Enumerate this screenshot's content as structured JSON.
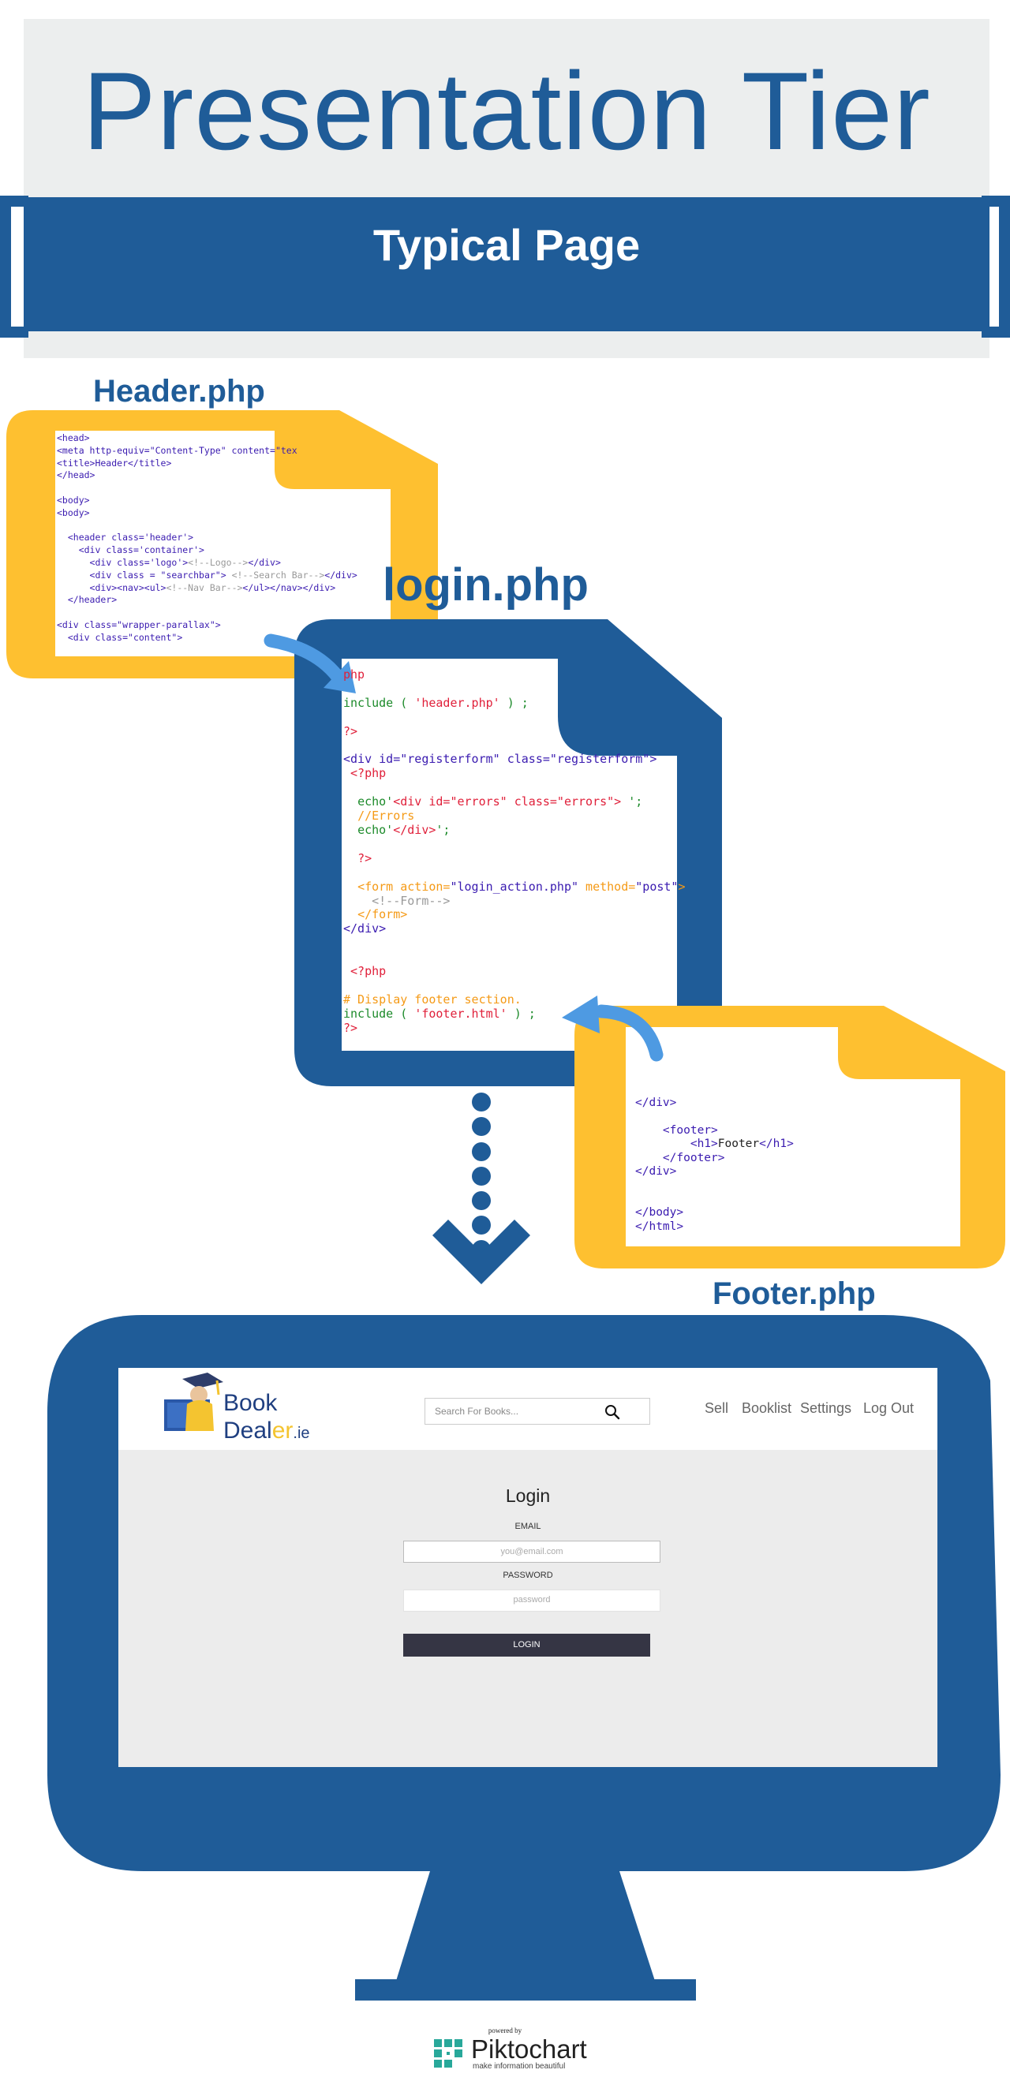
{
  "title": "Presentation Tier",
  "subtitle": "Typical Page",
  "files": {
    "header_label": "Header.php",
    "login_label": "login.php",
    "footer_label": "Footer.php"
  },
  "header_code": {
    "l1": "<head>",
    "l2": "<meta http-equiv=\"Content-Type\" content=\"tex",
    "l3": "<title>Header</title>",
    "l4": "</head>",
    "l5": "<body>",
    "l6": "<body>",
    "l7": "<header class='header'>",
    "l8": "<div class='container'>",
    "l9a": "<div class='logo'>",
    "l9b": "<!--Logo-->",
    "l9c": "</div>",
    "l10a": "<div class = \"searchbar\">",
    "l10b": " <!--Search Bar-->",
    "l10c": "</div>",
    "l11a": "<div><nav><ul>",
    "l11b": "<!--Nav Bar-->",
    "l11c": "</ul></nav></div>",
    "l12": "</header>",
    "l13": "<div class=\"wrapper-parallax\">",
    "l14": "<div class=\"content\">"
  },
  "login_code": {
    "l1": "php",
    "l2a": "include ( ",
    "l2b": "'header.php'",
    "l2c": " ) ;",
    "l3": "?>",
    "l4": "<div id=\"registerform\" class=\"registerform\">",
    "l5": "<?php",
    "l6a": "echo'",
    "l6b": "<div id=\"errors\" class=\"errors\">",
    "l6c": " ';",
    "l7": "//Errors",
    "l8a": "echo'",
    "l8b": "</div>",
    "l8c": "';",
    "l9": "?>",
    "l10a": "<form action=",
    "l10b": "\"login_action.php\"",
    "l10c": " method=",
    "l10d": "\"post\"",
    "l10e": ">",
    "l11": "<!--Form-->",
    "l12": "</form>",
    "l13": "</div>",
    "l14": "<?php",
    "l15": "# Display footer section.",
    "l16a": "include ( ",
    "l16b": "'footer.html'",
    "l16c": " ) ;",
    "l17": "?>"
  },
  "footer_code": {
    "l1": "</div>",
    "l2": "<footer>",
    "l3a": "<h1>",
    "l3b": "Footer",
    "l3c": "</h1>",
    "l4": "</footer>",
    "l5": "</div>",
    "l6": "</body>",
    "l7": "</html>"
  },
  "site": {
    "logo_book": "Book",
    "logo_deal": "Deal",
    "logo_er": "er",
    "logo_ie": ".ie",
    "search_placeholder": "Search For Books...",
    "nav": [
      "Sell",
      "Booklist",
      "Settings",
      "Log Out"
    ],
    "login_title": "Login",
    "email_label": "EMAIL",
    "email_placeholder": "you@email.com",
    "password_label": "PASSWORD",
    "password_placeholder": "password",
    "login_button": "LOGIN"
  },
  "branding": {
    "powered_by": "powered by",
    "name": "Piktochart",
    "tagline": "make information beautiful"
  },
  "colors": {
    "brand_blue": "#1f5c98",
    "accent_yellow": "#fec030",
    "arrow_blue": "#4e9ae2",
    "panel_grey": "#eceeee"
  }
}
